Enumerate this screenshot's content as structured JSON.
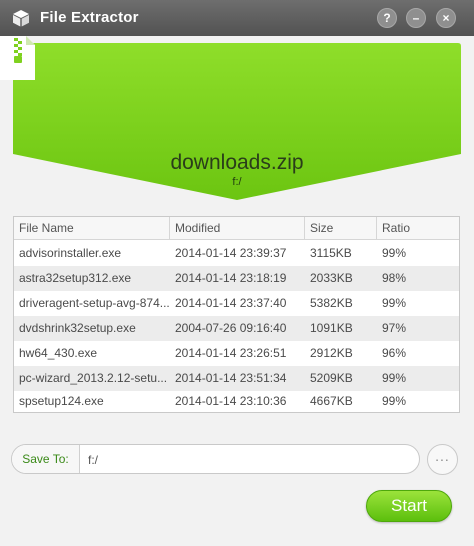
{
  "window": {
    "title": "File Extractor",
    "help_label": "?",
    "minimize_label": "–",
    "close_label": "×"
  },
  "archive": {
    "name": "downloads.zip",
    "path": "f:/"
  },
  "table": {
    "columns": [
      "File Name",
      "Modified",
      "Size",
      "Ratio"
    ],
    "rows": [
      {
        "name": "advisorinstaller.exe",
        "modified": "2014-01-14 23:39:37",
        "size": "3115KB",
        "ratio": "99%"
      },
      {
        "name": "astra32setup312.exe",
        "modified": "2014-01-14 23:18:19",
        "size": "2033KB",
        "ratio": "98%"
      },
      {
        "name": "driveragent-setup-avg-874...",
        "modified": "2014-01-14 23:37:40",
        "size": "5382KB",
        "ratio": "99%"
      },
      {
        "name": "dvdshrink32setup.exe",
        "modified": "2004-07-26 09:16:40",
        "size": "1091KB",
        "ratio": "97%"
      },
      {
        "name": "hw64_430.exe",
        "modified": "2014-01-14 23:26:51",
        "size": "2912KB",
        "ratio": "96%"
      },
      {
        "name": "pc-wizard_2013.2.12-setu...",
        "modified": "2014-01-14 23:51:34",
        "size": "5209KB",
        "ratio": "99%"
      },
      {
        "name": "spsetup124.exe",
        "modified": "2014-01-14 23:10:36",
        "size": "4667KB",
        "ratio": "99%"
      }
    ]
  },
  "save_to": {
    "label": "Save To:",
    "value": "f:/",
    "browse_label": "..."
  },
  "start_label": "Start",
  "colors": {
    "accent_green": "#7fd11f",
    "titlebar": "#5e5e5e"
  }
}
